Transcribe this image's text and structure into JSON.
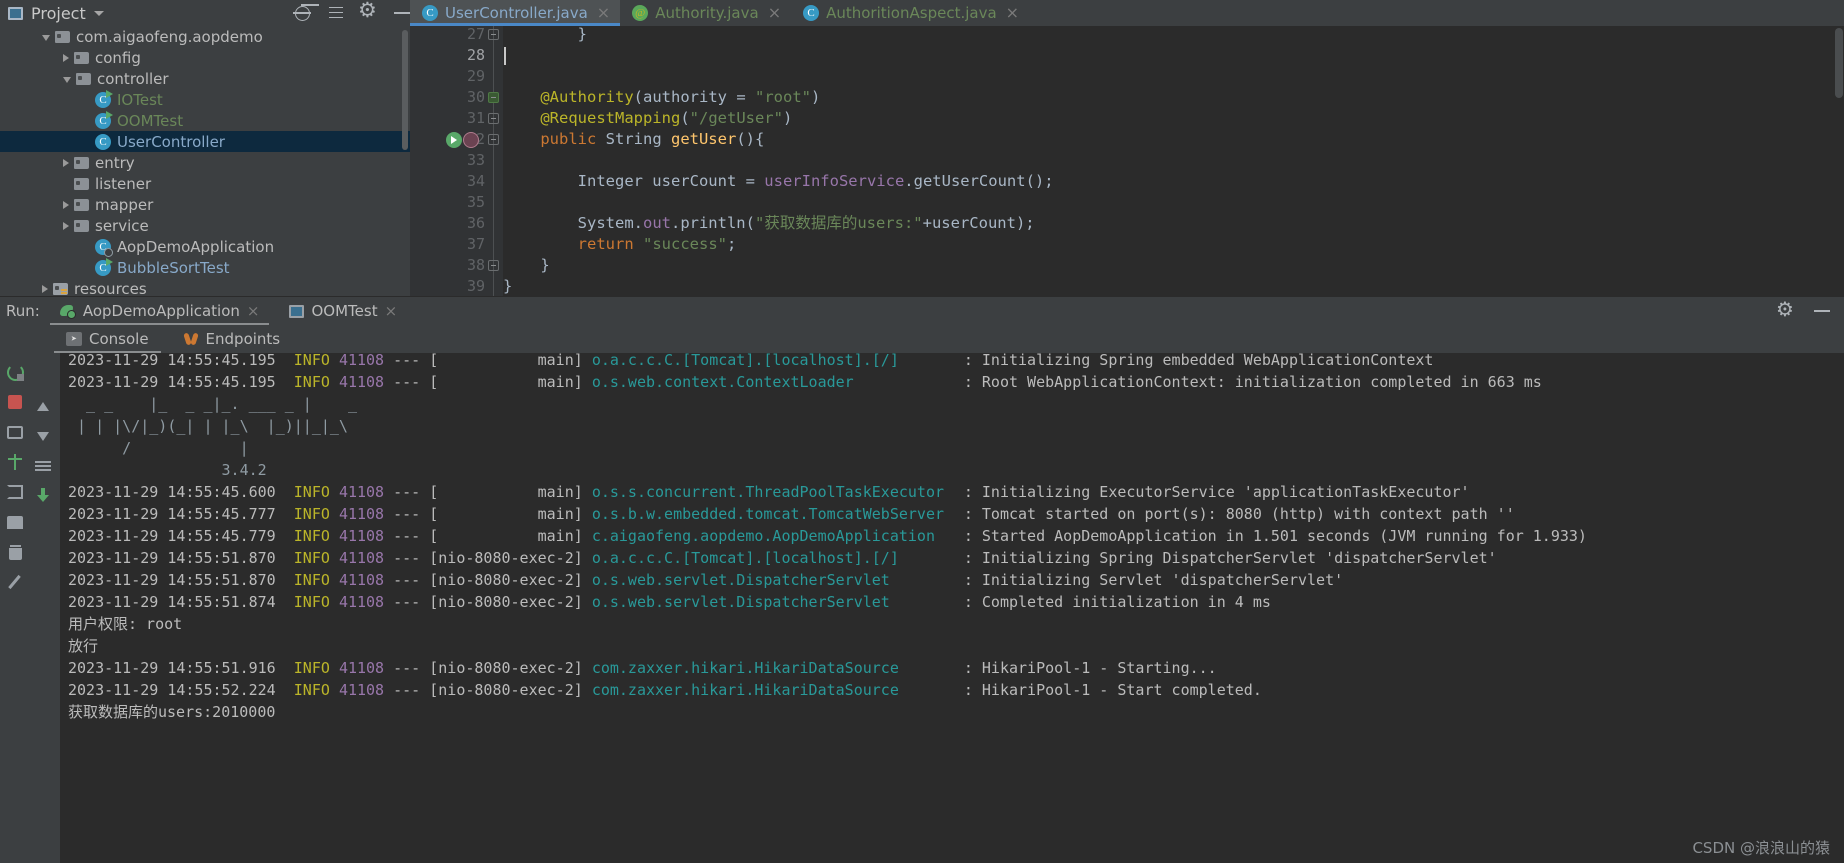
{
  "window": {
    "project_tool_label": "Project",
    "toolbar_icons": [
      "locate-icon",
      "collapse-all-icon",
      "settings-icon",
      "minimize-icon"
    ]
  },
  "editor": {
    "tabs": [
      {
        "label": "UserController.java",
        "icon": "class-icon",
        "active": true,
        "close": "×"
      },
      {
        "label": "Authority.java",
        "icon": "annotation-icon",
        "active": false,
        "close": "×"
      },
      {
        "label": "AuthoritionAspect.java",
        "icon": "class-icon",
        "active": false,
        "close": "×"
      }
    ],
    "lines": [
      {
        "num": "27",
        "fold": "plain",
        "segments": [
          {
            "t": "        }",
            "c": "plain"
          }
        ]
      },
      {
        "num": "28",
        "fold": null,
        "segments": [
          {
            "t": "",
            "c": "plain"
          }
        ],
        "caret": true,
        "current": true
      },
      {
        "num": "29",
        "fold": null,
        "segments": [
          {
            "t": "",
            "c": "plain"
          }
        ]
      },
      {
        "num": "30",
        "fold": "hl",
        "segments": [
          {
            "t": "    ",
            "c": "plain"
          },
          {
            "t": "@Authority",
            "c": "ann"
          },
          {
            "t": "(",
            "c": "plain"
          },
          {
            "t": "authority",
            "c": "plain"
          },
          {
            "t": " = ",
            "c": "plain"
          },
          {
            "t": "\"root\"",
            "c": "str"
          },
          {
            "t": ")",
            "c": "plain"
          }
        ]
      },
      {
        "num": "31",
        "fold": "plain",
        "segments": [
          {
            "t": "    ",
            "c": "plain"
          },
          {
            "t": "@RequestMapping",
            "c": "ann"
          },
          {
            "t": "(",
            "c": "plain"
          },
          {
            "t": "\"/getUser\"",
            "c": "str"
          },
          {
            "t": ")",
            "c": "plain"
          }
        ]
      },
      {
        "num": "32",
        "fold": "plain",
        "gutter_marks": [
          "run-gutter-icon",
          "spring-bean-icon"
        ],
        "segments": [
          {
            "t": "    ",
            "c": "plain"
          },
          {
            "t": "public",
            "c": "kw"
          },
          {
            "t": " String ",
            "c": "plain"
          },
          {
            "t": "getUser",
            "c": "meth"
          },
          {
            "t": "(){",
            "c": "plain"
          }
        ]
      },
      {
        "num": "33",
        "fold": null,
        "segments": [
          {
            "t": "",
            "c": "plain"
          }
        ]
      },
      {
        "num": "34",
        "fold": null,
        "segments": [
          {
            "t": "        Integer userCount = ",
            "c": "plain"
          },
          {
            "t": "userInfoService",
            "c": "fld"
          },
          {
            "t": ".getUserCount();",
            "c": "plain"
          }
        ]
      },
      {
        "num": "35",
        "fold": null,
        "segments": [
          {
            "t": "",
            "c": "plain"
          }
        ]
      },
      {
        "num": "36",
        "fold": null,
        "segments": [
          {
            "t": "        System.",
            "c": "plain"
          },
          {
            "t": "out",
            "c": "fld"
          },
          {
            "t": ".println(",
            "c": "plain"
          },
          {
            "t": "\"获取数据库的users:\"",
            "c": "str"
          },
          {
            "t": "+userCount);",
            "c": "plain"
          }
        ]
      },
      {
        "num": "37",
        "fold": null,
        "segments": [
          {
            "t": "        ",
            "c": "plain"
          },
          {
            "t": "return",
            "c": "kw"
          },
          {
            "t": " ",
            "c": "plain"
          },
          {
            "t": "\"success\"",
            "c": "str"
          },
          {
            "t": ";",
            "c": "plain"
          }
        ]
      },
      {
        "num": "38",
        "fold": "plain",
        "segments": [
          {
            "t": "    }",
            "c": "plain"
          }
        ]
      },
      {
        "num": "39",
        "fold": null,
        "segments": [
          {
            "t": "}",
            "c": "plain"
          }
        ]
      }
    ]
  },
  "project_tree": [
    {
      "label": "com.aigaofeng.aopdemo",
      "indent": 2,
      "arrow": "open",
      "icon": "folder-icon",
      "color": "white"
    },
    {
      "label": "config",
      "indent": 3,
      "arrow": "closed",
      "icon": "folder-icon",
      "color": "white"
    },
    {
      "label": "controller",
      "indent": 3,
      "arrow": "open",
      "icon": "folder-icon",
      "color": "white"
    },
    {
      "label": "IOTest",
      "indent": 4,
      "arrow": "none",
      "icon": "class-runnable-icon",
      "color": "green"
    },
    {
      "label": "OOMTest",
      "indent": 4,
      "arrow": "none",
      "icon": "class-runnable-icon",
      "color": "green"
    },
    {
      "label": "UserController",
      "indent": 4,
      "arrow": "none",
      "icon": "class-icon",
      "color": "blue",
      "selected": true
    },
    {
      "label": "entry",
      "indent": 3,
      "arrow": "closed",
      "icon": "folder-icon",
      "color": "white"
    },
    {
      "label": "listener",
      "indent": 3,
      "arrow": "none",
      "icon": "folder-icon",
      "color": "white"
    },
    {
      "label": "mapper",
      "indent": 3,
      "arrow": "closed",
      "icon": "folder-icon",
      "color": "white"
    },
    {
      "label": "service",
      "indent": 3,
      "arrow": "closed",
      "icon": "folder-icon",
      "color": "white"
    },
    {
      "label": "AopDemoApplication",
      "indent": 4,
      "arrow": "none",
      "icon": "class-spring-icon",
      "color": "white"
    },
    {
      "label": "BubbleSortTest",
      "indent": 4,
      "arrow": "none",
      "icon": "class-runnable-icon",
      "color": "blue"
    },
    {
      "label": "resources",
      "indent": 2,
      "arrow": "closed",
      "icon": "resources-folder-icon",
      "color": "white"
    }
  ],
  "run_panel": {
    "label": "Run:",
    "tabs": [
      {
        "label": "AopDemoApplication",
        "icon": "spring-boot-icon",
        "active": true,
        "close": "×"
      },
      {
        "label": "OOMTest",
        "icon": "application-icon",
        "active": false,
        "close": "×"
      }
    ],
    "sub_tabs": [
      {
        "label": "Console",
        "icon": "console-icon",
        "active": true
      },
      {
        "label": "Endpoints",
        "icon": "endpoints-icon",
        "active": false
      }
    ],
    "gear_icon": "settings-icon",
    "minimize_icon": "minimize-icon",
    "tool_buttons": [
      "rerun-icon",
      "stop-icon",
      "screenshot-icon",
      "thread-dump-icon",
      "exit-icon",
      "print-icon",
      "clear-all-icon",
      "pin-icon",
      "scroll-up-icon",
      "scroll-down-icon",
      "scroll-to-end-icon",
      "soft-wrap-icon"
    ]
  },
  "console": {
    "lines": [
      {
        "type": "log",
        "ts": "2023-11-29 14:55:45.195",
        "level": "INFO",
        "pid": "41108",
        "sep": "---",
        "thread": "[           main]",
        "logger": "o.a.c.c.C.[Tomcat].[localhost].[/]",
        "msg": ": Initializing Spring embedded WebApplicationContext",
        "clipped": true
      },
      {
        "type": "log",
        "ts": "2023-11-29 14:55:45.195",
        "level": "INFO",
        "pid": "41108",
        "sep": "---",
        "thread": "[           main]",
        "logger": "o.s.web.context.ContextLoader",
        "msg": ": Root WebApplicationContext: initialization completed in 663 ms"
      },
      {
        "type": "banner",
        "text": "  _ _    |_  _ _|_. ___ _ |    _ "
      },
      {
        "type": "banner",
        "text": " | | |\\/|_)(_| | |_\\  |_)||_|_\\"
      },
      {
        "type": "banner",
        "text": "      /            |             "
      },
      {
        "type": "banner",
        "text": "                 3.4.2"
      },
      {
        "type": "log",
        "ts": "2023-11-29 14:55:45.600",
        "level": "INFO",
        "pid": "41108",
        "sep": "---",
        "thread": "[           main]",
        "logger": "o.s.s.concurrent.ThreadPoolTaskExecutor",
        "msg": ": Initializing ExecutorService 'applicationTaskExecutor'"
      },
      {
        "type": "log",
        "ts": "2023-11-29 14:55:45.777",
        "level": "INFO",
        "pid": "41108",
        "sep": "---",
        "thread": "[           main]",
        "logger": "o.s.b.w.embedded.tomcat.TomcatWebServer",
        "msg": ": Tomcat started on port(s): 8080 (http) with context path ''"
      },
      {
        "type": "log",
        "ts": "2023-11-29 14:55:45.779",
        "level": "INFO",
        "pid": "41108",
        "sep": "---",
        "thread": "[           main]",
        "logger": "c.aigaofeng.aopdemo.AopDemoApplication",
        "msg": ": Started AopDemoApplication in 1.501 seconds (JVM running for 1.933)"
      },
      {
        "type": "log",
        "ts": "2023-11-29 14:55:51.870",
        "level": "INFO",
        "pid": "41108",
        "sep": "---",
        "thread": "[nio-8080-exec-2]",
        "logger": "o.a.c.c.C.[Tomcat].[localhost].[/]",
        "msg": ": Initializing Spring DispatcherServlet 'dispatcherServlet'"
      },
      {
        "type": "log",
        "ts": "2023-11-29 14:55:51.870",
        "level": "INFO",
        "pid": "41108",
        "sep": "---",
        "thread": "[nio-8080-exec-2]",
        "logger": "o.s.web.servlet.DispatcherServlet",
        "msg": ": Initializing Servlet 'dispatcherServlet'"
      },
      {
        "type": "log",
        "ts": "2023-11-29 14:55:51.874",
        "level": "INFO",
        "pid": "41108",
        "sep": "---",
        "thread": "[nio-8080-exec-2]",
        "logger": "o.s.web.servlet.DispatcherServlet",
        "msg": ": Completed initialization in 4 ms"
      },
      {
        "type": "plain",
        "text": "用户权限: root"
      },
      {
        "type": "plain",
        "text": "放行"
      },
      {
        "type": "log",
        "ts": "2023-11-29 14:55:51.916",
        "level": "INFO",
        "pid": "41108",
        "sep": "---",
        "thread": "[nio-8080-exec-2]",
        "logger": "com.zaxxer.hikari.HikariDataSource",
        "msg": ": HikariPool-1 - Starting..."
      },
      {
        "type": "log",
        "ts": "2023-11-29 14:55:52.224",
        "level": "INFO",
        "pid": "41108",
        "sep": "---",
        "thread": "[nio-8080-exec-2]",
        "logger": "com.zaxxer.hikari.HikariDataSource",
        "msg": ": HikariPool-1 - Start completed."
      },
      {
        "type": "plain",
        "text": "获取数据库的users:2010000"
      }
    ]
  },
  "watermark": {
    "text": "CSDN @浪浪山的猿"
  },
  "colors": {
    "panel_bg": "#3c3f41",
    "editor_bg": "#2b2b2b",
    "selection": "#0d293e",
    "tab_active_underline": "#4a88c7",
    "string": "#6a8759",
    "annotation": "#bbb529",
    "keyword": "#cc7832",
    "field": "#9876aa",
    "method": "#ffc66d",
    "logger": "#299999"
  }
}
